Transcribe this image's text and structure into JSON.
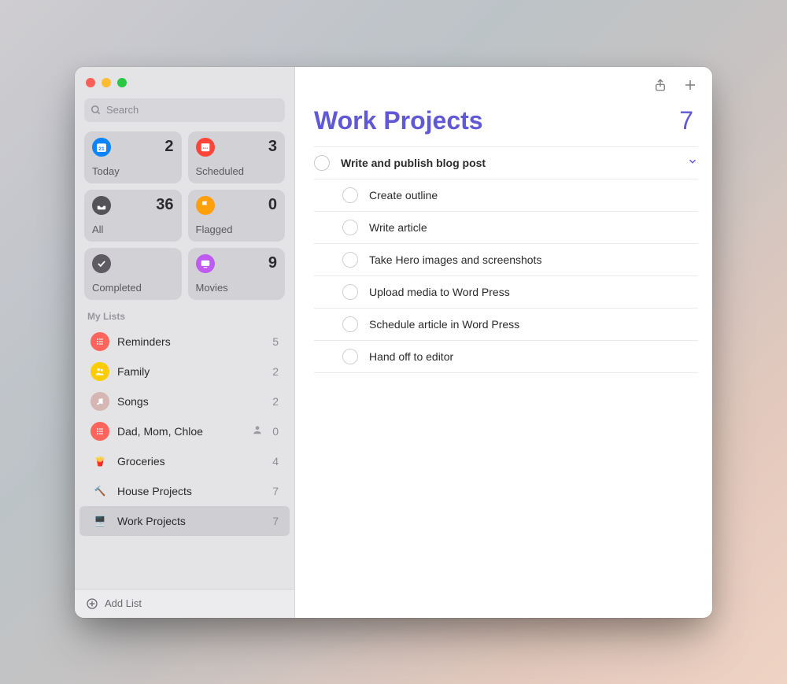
{
  "search": {
    "placeholder": "Search"
  },
  "smart": [
    {
      "id": "today",
      "label": "Today",
      "count": "2",
      "icon_text": "21"
    },
    {
      "id": "scheduled",
      "label": "Scheduled",
      "count": "3"
    },
    {
      "id": "all",
      "label": "All",
      "count": "36"
    },
    {
      "id": "flagged",
      "label": "Flagged",
      "count": "0"
    },
    {
      "id": "completed",
      "label": "Completed",
      "count": ""
    },
    {
      "id": "movies",
      "label": "Movies",
      "count": "9"
    }
  ],
  "section_label": "My Lists",
  "lists": [
    {
      "name": "Reminders",
      "count": "5",
      "shared": false
    },
    {
      "name": "Family",
      "count": "2",
      "shared": false
    },
    {
      "name": "Songs",
      "count": "2",
      "shared": false
    },
    {
      "name": "Dad, Mom, Chloe",
      "count": "0",
      "shared": true
    },
    {
      "name": "Groceries",
      "count": "4",
      "shared": false
    },
    {
      "name": "House Projects",
      "count": "7",
      "shared": false
    },
    {
      "name": "Work Projects",
      "count": "7",
      "shared": false,
      "selected": true
    }
  ],
  "add_list_label": "Add List",
  "main": {
    "title": "Work Projects",
    "count": "7",
    "parent_task": "Write and publish blog post",
    "subtasks": [
      "Create outline",
      "Write article",
      "Take Hero images and screenshots",
      "Upload media to Word Press",
      "Schedule article in Word Press",
      "Hand off to editor"
    ]
  }
}
